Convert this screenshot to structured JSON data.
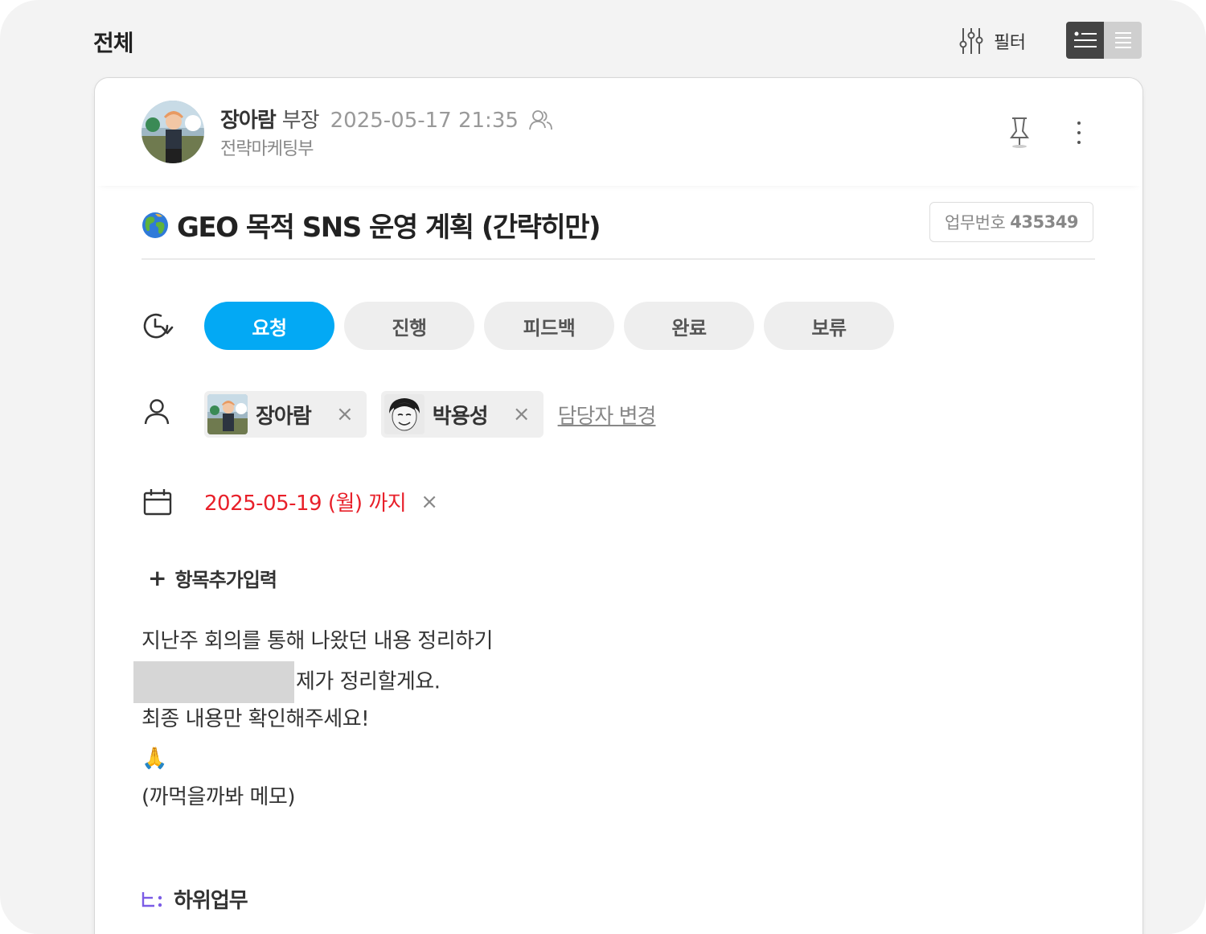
{
  "header": {
    "title": "전체",
    "filter_label": "필터",
    "view_modes": [
      "list-detail-icon",
      "list-compact-icon"
    ]
  },
  "post": {
    "author_name": "장아람",
    "author_title": "부장",
    "datetime": "2025-05-17 21:35",
    "department": "전략마케팅부",
    "title": "GEO 목적 SNS 운영 계획 (간략히만)",
    "task_no_label": "업무번호",
    "task_no": "435349"
  },
  "status": {
    "options": [
      "요청",
      "진행",
      "피드백",
      "완료",
      "보류"
    ],
    "selected": "요청",
    "accent_color": "#03a9f4"
  },
  "assignees": {
    "people": [
      {
        "name": "장아람",
        "remove": "×"
      },
      {
        "name": "박용성",
        "remove": "×"
      }
    ],
    "change_label": "담당자 변경"
  },
  "due": {
    "text": "2025-05-19 (월) 까지",
    "remove": "×",
    "color": "#e8202a"
  },
  "add_item": {
    "plus": "+",
    "label": "항목추가입력"
  },
  "body": {
    "line1": "지난주 회의를 통해 나왔던 내용 정리하기",
    "line2": "제가 정리할게요.",
    "line3": "최종 내용만 확인해주세요!",
    "line4": "🙏",
    "line5": "(까먹을까봐 메모)"
  },
  "subtask": {
    "label": "하위업무"
  }
}
